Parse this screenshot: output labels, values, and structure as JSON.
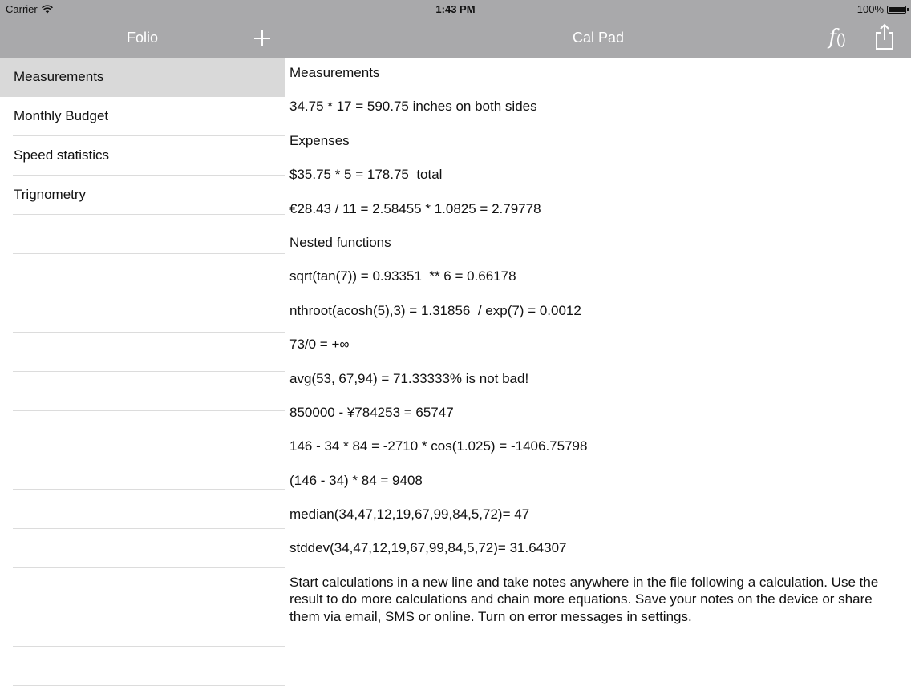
{
  "status_bar": {
    "carrier": "Carrier",
    "time": "1:43 PM",
    "battery": "100%"
  },
  "sidebar_header": {
    "title": "Folio",
    "add_icon": "plus-icon"
  },
  "main_header": {
    "title": "Cal Pad",
    "function_symbol": "f",
    "function_parens": "()",
    "share_icon": "share-icon"
  },
  "sidebar": {
    "items": [
      {
        "label": "Measurements",
        "selected": true
      },
      {
        "label": "Monthly Budget",
        "selected": false
      },
      {
        "label": "Speed statistics",
        "selected": false
      },
      {
        "label": "Trignometry",
        "selected": false
      }
    ],
    "empty_rows": 12
  },
  "document": {
    "lines": [
      "Measurements",
      "34.75 * 17 = 590.75 inches on both sides",
      "Expenses",
      "$35.75 * 5 = 178.75  total",
      "€28.43 / 11 = 2.58455 * 1.0825 = 2.79778",
      "Nested functions",
      "sqrt(tan(7)) = 0.93351  ** 6 = 0.66178",
      "nthroot(acosh(5),3) = 1.31856  / exp(7) = 0.0012",
      "73/0 = +∞",
      "avg(53, 67,94) = 71.33333% is not bad!",
      "850000 - ¥784253 = 65747",
      "146 - 34 * 84 = -2710 * cos(1.025) = -1406.75798",
      "(146 - 34) * 84 = 9408",
      "median(34,47,12,19,67,99,84,5,72)= 47",
      "stddev(34,47,12,19,67,99,84,5,72)= 31.64307"
    ],
    "paragraph": "Start calculations in a new line and take notes anywhere in the file following a calculation. Use the result to do more calculations and chain more equations. Save your notes on the device or share them via email, SMS or online. Turn on error messages in settings."
  }
}
